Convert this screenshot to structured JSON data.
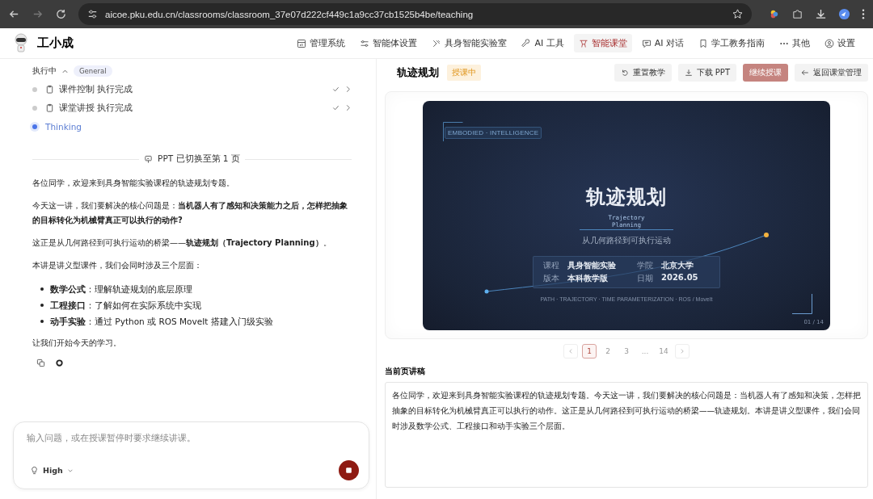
{
  "browser": {
    "url": "aicoe.pku.edu.cn/classrooms/classroom_37e07d222cf449c1a9cc37cb1525b4be/teaching"
  },
  "app": {
    "name": "工小成",
    "nav": [
      {
        "label": "管理系统",
        "selected": false
      },
      {
        "label": "智能体设置",
        "selected": false
      },
      {
        "label": "具身智能实验室",
        "selected": false
      },
      {
        "label": "AI 工具",
        "selected": false
      },
      {
        "label": "智能课堂",
        "selected": true
      },
      {
        "label": "AI 对话",
        "selected": false
      },
      {
        "label": "学工教务指南",
        "selected": false
      },
      {
        "label": "其他",
        "selected": false
      },
      {
        "label": "设置",
        "selected": false
      }
    ]
  },
  "chat": {
    "status": {
      "label": "执行中",
      "tag": "General",
      "expanded": true
    },
    "steps": [
      {
        "label": "课件控制 执行完成",
        "completed": true
      },
      {
        "label": "课堂讲授 执行完成",
        "completed": true
      },
      {
        "label": "Thinking",
        "completed": false
      }
    ],
    "notice": "PPT 已切换至第 1 页",
    "paragraphs": [
      "各位同学，欢迎来到具身智能实验课程的轨迹规划专题。",
      "今天这一讲，我们要解决的核心问题是：**当机器人有了感知和决策能力之后，怎样把抽象的目标转化为机械臂真正可以执行的动作?**",
      "这正是从几何路径到可执行运动的桥梁——**轨迹规划（Trajectory Planning）**。",
      "本讲是讲义型课件，我们会同时涉及三个层面："
    ],
    "bullets": [
      "**数学公式**：理解轨迹规划的底层原理",
      "**工程接口**：了解如何在实际系统中实现",
      "**动手实验**：通过 Python 或 ROS MoveIt 搭建入门级实验"
    ],
    "closing": "让我们开始今天的学习。",
    "input": {
      "placeholder": "输入问题，或在授课暂停时要求继续讲课。"
    },
    "mode": "High"
  },
  "lesson": {
    "title": "轨迹规划",
    "badge": "授课中",
    "actions": [
      {
        "label": "重置教学",
        "kind": "reset",
        "disabled": false
      },
      {
        "label": "下载 PPT",
        "kind": "download",
        "disabled": false
      },
      {
        "label": "继续授课",
        "kind": "primary",
        "disabled": true
      },
      {
        "label": "返回课堂管理",
        "kind": "back",
        "disabled": false
      }
    ],
    "slide": {
      "tag": "EMBODIED · INTELLIGENCE",
      "title": "轨迹规划",
      "subtitle_en": "Trajectory Planning",
      "subtitle": "从几何路径到可执行运动",
      "info": [
        {
          "key": "课程",
          "value": "具身智能实验"
        },
        {
          "key": "学院",
          "value": "北京大学"
        },
        {
          "key": "版本",
          "value": "本科教学版"
        },
        {
          "key": "日期",
          "value": "2026.05"
        }
      ],
      "footer": "PATH · TRAJECTORY · TIME PARAMETERIZATION · ROS / MoveIt",
      "page": "01 / 14"
    },
    "pages": [
      {
        "label": "1",
        "selected": true
      },
      {
        "label": "2",
        "selected": false
      },
      {
        "label": "3",
        "selected": false
      },
      {
        "label": "...",
        "selected": false
      },
      {
        "label": "14",
        "selected": false
      }
    ],
    "script_title": "当前页讲稿",
    "script": "各位同学，欢迎来到具身智能实验课程的轨迹规划专题。今天这一讲，我们要解决的核心问题是：当机器人有了感知和决策，怎样把抽象的目标转化为机械臂真正可以执行的动作。这正是从几何路径到可执行运动的桥梁——轨迹规划。本讲是讲义型课件，我们会同时涉及数学公式、工程接口和动手实验三个层面。"
  }
}
